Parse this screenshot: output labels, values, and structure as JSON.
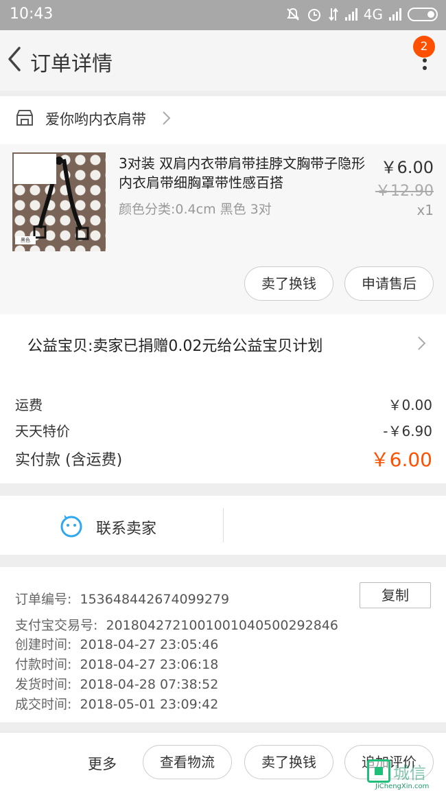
{
  "status_bar": {
    "time": "10:43",
    "network": "4G"
  },
  "nav": {
    "title": "订单详情",
    "badge": "2"
  },
  "shop": {
    "name": "爱你哟内衣肩带"
  },
  "item": {
    "title": "3对装 双肩内衣带肩带挂脖文胸带子隐形内衣肩带细胸罩带性感百搭",
    "sku": "颜色分类:0.4cm 黑色  3对",
    "price": "￥6.00",
    "original_price": "￥12.90",
    "quantity": "x1",
    "thumb_label": "黑色",
    "buttons": {
      "sell": "卖了换钱",
      "after_sale": "申请售后"
    }
  },
  "charity": {
    "text": "公益宝贝:卖家已捐赠0.02元给公益宝贝计划"
  },
  "fees": {
    "shipping_label": "运费",
    "shipping_value": "￥0.00",
    "discount_label": "天天特价",
    "discount_value": "-￥6.90",
    "paid_label": "实付款 (含运费)",
    "paid_value": "￥6.00"
  },
  "contact": {
    "label": "联系卖家"
  },
  "order_info": {
    "order_no_label": "订单编号:",
    "order_no": "1536484426740992​79",
    "alipay_label": "支付宝交易号:",
    "alipay_no": "2018042721001001040500292846",
    "created_label": "创建时间:",
    "created": "2018-04-27 23:05:46",
    "paid_label": "付款时间:",
    "paid": "2018-04-27 23:06:18",
    "shipped_label": "发货时间:",
    "shipped": "2018-04-28 07:38:52",
    "done_label": "成交时间:",
    "done": "2018-05-01 23:09:42",
    "copy_label": "复制"
  },
  "bottom_bar": {
    "more": "更多",
    "logistics": "查看物流",
    "sell": "卖了换钱",
    "review": "追加评价"
  },
  "watermark": {
    "cn": "城信",
    "en": "JiChengXin.com"
  },
  "colors": {
    "accent": "#ff5000",
    "contact_icon": "#2fa8f0",
    "watermark": "#1fbf7a"
  }
}
